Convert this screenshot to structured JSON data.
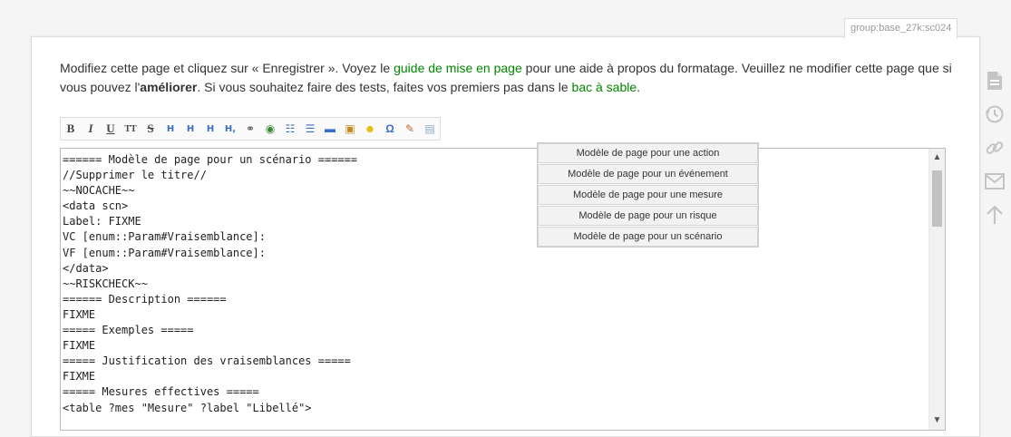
{
  "page_id": "group:base_27k:sc024",
  "intro": {
    "part1": "Modifiez cette page et cliquez sur « Enregistrer ». Voyez le ",
    "link_guide": "guide de mise en page",
    "part2": " pour une aide à propos du formatage. Veuillez ne modifier cette page que si vous pouvez l'",
    "bold": "améliorer",
    "part3": ". Si vous souhaitez faire des tests, faites vos premiers pas dans le ",
    "link_sandbox": "bac à sable",
    "part4": "."
  },
  "toolbar": {
    "bold": "B",
    "italic": "I",
    "underline": "U",
    "mono": "TT",
    "strike": "S",
    "h_same": "H",
    "h_lower": "H",
    "h_higher": "H",
    "h_select": "H,",
    "link": "⚭",
    "ext_link": "◉",
    "ol": "☷",
    "ul": "☰",
    "hr": "▬",
    "image": "▣",
    "smiley": "☻",
    "special": "Ω",
    "signature": "✎",
    "template": "▤"
  },
  "template_menu": [
    "Modèle de page pour une action",
    "Modèle de page pour un événement",
    "Modèle de page pour une mesure",
    "Modèle de page pour un risque",
    "Modèle de page pour un scénario"
  ],
  "editor_text": "====== Modèle de page pour un scénario ======\n//Supprimer le titre//\n~~NOCACHE~~\n<data scn>\nLabel: FIXME\nVC [enum::Param#Vraisemblance]:\nVF [enum::Param#Vraisemblance]:\n</data>\n~~RISKCHECK~~\n====== Description ======\nFIXME\n===== Exemples =====\nFIXME\n===== Justification des vraisemblances =====\nFIXME\n===== Mesures effectives =====\n<table ?mes \"Mesure\" ?label \"Libellé\">",
  "colors": {
    "accent_link": "#008800",
    "icon_gray": "#c4c4c4"
  },
  "page_tools": [
    "file-icon",
    "history-icon",
    "link-icon",
    "mail-icon",
    "arrow-up-icon"
  ]
}
